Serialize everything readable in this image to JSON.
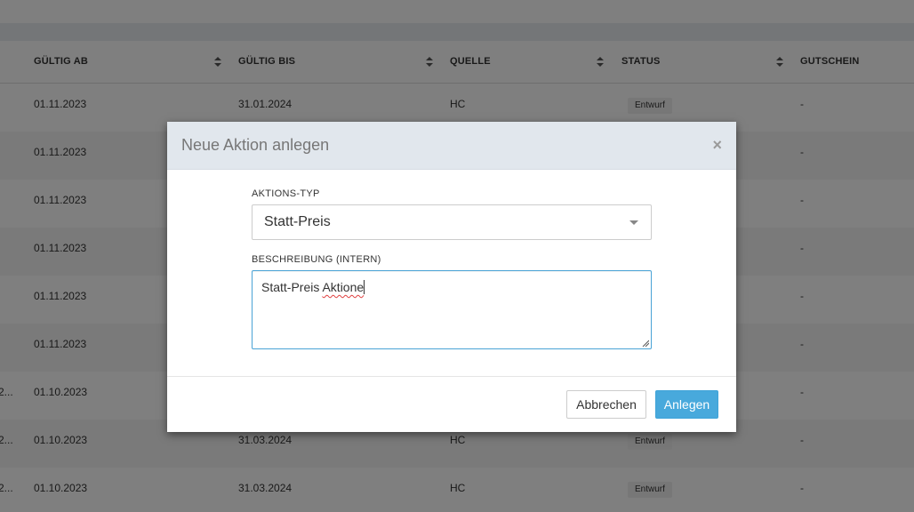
{
  "table": {
    "headers": [
      {
        "label": "GÜLTIG AB",
        "sortable": true
      },
      {
        "label": "GÜLTIG BIS",
        "sortable": true
      },
      {
        "label": "QUELLE",
        "sortable": true
      },
      {
        "label": "STATUS",
        "sortable": true
      },
      {
        "label": "GUTSCHEIN",
        "sortable": false
      }
    ],
    "rows": [
      {
        "pre": "",
        "gueltig_ab": "01.11.2023",
        "gueltig_bis": "31.01.2024",
        "quelle": "HC",
        "status": "Entwurf",
        "gutschein": "-"
      },
      {
        "pre": "",
        "gueltig_ab": "01.11.2023",
        "gueltig_bis": "",
        "quelle": "",
        "status": "",
        "gutschein": "-"
      },
      {
        "pre": "",
        "gueltig_ab": "01.11.2023",
        "gueltig_bis": "",
        "quelle": "",
        "status": "",
        "gutschein": "-"
      },
      {
        "pre": "",
        "gueltig_ab": "01.11.2023",
        "gueltig_bis": "",
        "quelle": "",
        "status": "",
        "gutschein": "-"
      },
      {
        "pre": "",
        "gueltig_ab": "01.11.2023",
        "gueltig_bis": "",
        "quelle": "",
        "status": "",
        "gutschein": "-"
      },
      {
        "pre": "",
        "gueltig_ab": "01.11.2023",
        "gueltig_bis": "",
        "quelle": "",
        "status": "",
        "gutschein": "-"
      },
      {
        "pre": "2...",
        "gueltig_ab": "01.10.2023",
        "gueltig_bis": "",
        "quelle": "",
        "status": "",
        "gutschein": "-"
      },
      {
        "pre": "2...",
        "gueltig_ab": "01.10.2023",
        "gueltig_bis": "31.03.2024",
        "quelle": "HC",
        "status": "Entwurf",
        "gutschein": "-"
      },
      {
        "pre": "2...",
        "gueltig_ab": "01.10.2023",
        "gueltig_bis": "31.03.2024",
        "quelle": "HC",
        "status": "Entwurf",
        "gutschein": "-"
      }
    ]
  },
  "modal": {
    "title": "Neue Aktion anlegen",
    "close_glyph": "×",
    "type_label": "AKTIONS-TYP",
    "type_value": "Statt-Preis",
    "description_label": "BESCHREIBUNG (INTERN)",
    "description_value_plain": "Statt-Preis ",
    "description_value_misspelled": "Aktione",
    "cancel_label": "Abbrechen",
    "submit_label": "Anlegen"
  },
  "icons": {
    "sort": "sort-icon",
    "close": "close-icon",
    "dropdown": "chevron-down-icon",
    "resize": "resize-handle-icon"
  },
  "colors": {
    "overlay": "#000000",
    "modal_header": "#e1e7ed",
    "primary": "#48a9dc",
    "focus_border": "#4aa3d6",
    "badge_bg": "#eeeeee"
  }
}
